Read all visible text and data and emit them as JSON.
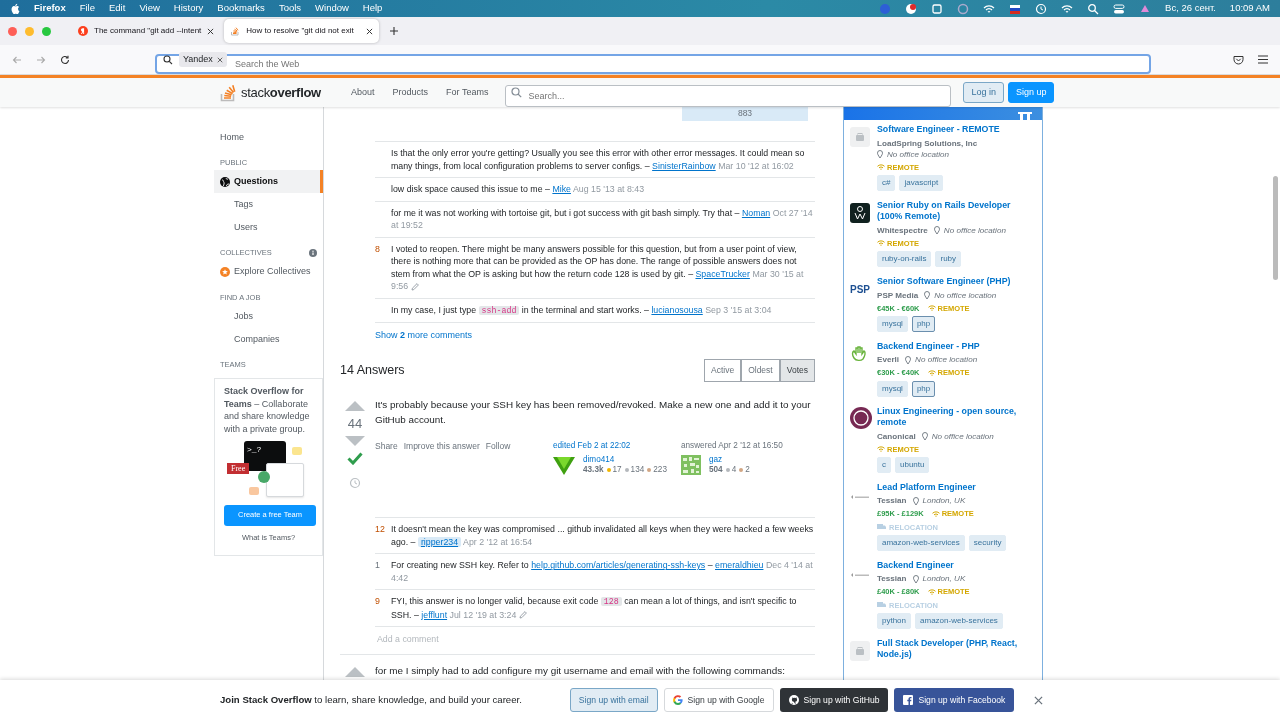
{
  "menubar": {
    "app": "Firefox",
    "items": [
      "File",
      "Edit",
      "View",
      "History",
      "Bookmarks",
      "Tools",
      "Window",
      "Help"
    ],
    "date": "Вс, 26 сент.",
    "time": "10:09 AM"
  },
  "browser_tabs": [
    {
      "title": "The command \"git add --intent",
      "selected": false
    },
    {
      "title": "How to resolve \"git did not exit",
      "selected": true
    }
  ],
  "address_bar": {
    "engine": "Yandex",
    "placeholder": "Search the Web"
  },
  "site_header": {
    "logo": "stack**overflow**",
    "nav": [
      "About",
      "Products",
      "For Teams"
    ],
    "search_placeholder": "Search...",
    "buttons": [
      {
        "kind": "secondary",
        "label": "Log in"
      },
      {
        "kind": "primary",
        "label": "Sign up"
      }
    ]
  },
  "sidebar": {
    "items": [
      {
        "kind": "link",
        "label": "Home",
        "selected": false
      },
      {
        "kind": "heading",
        "label": "PUBLIC"
      },
      {
        "kind": "link",
        "label": "Questions",
        "selected": true
      },
      {
        "kind": "sublink",
        "label": "Tags",
        "selected": false
      },
      {
        "kind": "sublink",
        "label": "Users",
        "selected": false
      },
      {
        "kind": "heading",
        "label": "COLLECTIVES",
        "info": true
      },
      {
        "kind": "link",
        "label": "Explore Collectives",
        "selected": false
      },
      {
        "kind": "heading",
        "label": "FIND A JOB"
      },
      {
        "kind": "sublink",
        "label": "Jobs",
        "selected": false
      },
      {
        "kind": "sublink",
        "label": "Companies",
        "selected": false
      },
      {
        "kind": "heading",
        "label": "TEAMS"
      }
    ],
    "teams_card": {
      "text": "**Stack Overflow for Teams** – Collaborate and share knowledge with a private group.",
      "terminal": ">_?",
      "badge": "Free",
      "button": "Create a free Team",
      "link": "What is Teams?"
    }
  },
  "question": {
    "views_box": "883",
    "comments": [
      {
        "segments": [
          {
            "kind": "text",
            "text": "Is that the only error you're getting? Usually you see this error with other error messages. It could mean so many things, from local configuration problems to server configs. –"
          }
        ],
        "user": "SinisterRainbow",
        "date": "Mar 10 '12 at 16:02",
        "edited": false
      },
      {
        "segments": [
          {
            "kind": "text",
            "text": "low disk space caused this issue to me –"
          }
        ],
        "user": "Mike",
        "date": "Aug 15 '13 at 8:43",
        "edited": false
      },
      {
        "segments": [
          {
            "kind": "text",
            "text": "for me it was not working with tortoise git, but i got success with git bash simply. Try that –"
          }
        ],
        "user": "Noman",
        "date": "Oct 27 '14 at 19:52",
        "edited": false
      },
      {
        "score": "8",
        "segments": [
          {
            "kind": "text",
            "text": "I voted to reopen. There might be many answers possible for this question, but from a user point of view, there is nothing more that can be provided as the OP has done. The range of possible answers does not stem from what the OP is asking but how the return code 128 is used by git. –"
          }
        ],
        "user": "SpaceTrucker",
        "date": "Mar 30 '15 at 9:56",
        "edited": true
      },
      {
        "segments": [
          {
            "kind": "text",
            "text": "In my case, I just type "
          },
          {
            "kind": "code",
            "text": "ssh-add"
          },
          {
            "kind": "text",
            "text": " in the terminal and start works. –"
          }
        ],
        "user": "lucianosousa",
        "date": "Sep 3 '15 at 3:04",
        "edited": false
      }
    ],
    "show_more": "Show **2** more comments"
  },
  "answers_header": {
    "title": "14 Answers",
    "sort": [
      {
        "label": "Active",
        "selected": false
      },
      {
        "label": "Oldest",
        "selected": false
      },
      {
        "label": "Votes",
        "selected": true
      }
    ]
  },
  "answer": {
    "score": "44",
    "accepted": true,
    "body": "It's probably because your SSH key has been removed/revoked. Make a new one and add it to your GitHub account.",
    "actions": [
      "Share",
      "Improve this answer",
      "Follow"
    ],
    "edited": {
      "label": "edited Feb 2 at 22:02",
      "user": "dimo414",
      "rep": "43.3k",
      "badges": [
        {
          "kind": "gold",
          "count": "17"
        },
        {
          "kind": "silver",
          "count": "134"
        },
        {
          "kind": "bronze",
          "count": "223"
        }
      ]
    },
    "answered": {
      "label": "answered Apr 2 '12 at 16:50",
      "user": "gaz",
      "rep": "504",
      "badges": [
        {
          "kind": "silver",
          "count": "4"
        },
        {
          "kind": "bronze",
          "count": "2"
        }
      ]
    },
    "comments": [
      {
        "score": "12",
        "segments": [
          {
            "kind": "text",
            "text": "It doesn't mean the key was compromised ... github invalidated all keys when they were hacked a few weeks ago. –"
          }
        ],
        "user": "ripper234",
        "op": true,
        "date": "Apr 2 '12 at 16:54",
        "edited": false
      },
      {
        "score": "1",
        "segments": [
          {
            "kind": "text",
            "text": "For creating new SSH key. Refer to "
          },
          {
            "kind": "link",
            "text": "help.github.com/articles/generating-ssh-keys"
          },
          {
            "kind": "text",
            "text": " –"
          }
        ],
        "user": "emeraldhieu",
        "op": false,
        "date": "Dec 4 '14 at 4:42",
        "edited": false
      },
      {
        "score": "9",
        "segments": [
          {
            "kind": "text",
            "text": "FYI, this answer is no longer valid, because exit code "
          },
          {
            "kind": "code",
            "text": "128"
          },
          {
            "kind": "text",
            "text": " can mean a lot of things, and isn't specific to SSH. –"
          }
        ],
        "user": "jefflunt",
        "op": false,
        "date": "Jul 12 '19 at 3:24",
        "edited": true
      }
    ],
    "add_comment": "Add a comment"
  },
  "next_answer": {
    "body": "for me I simply had to add configure my git username and email with the following commands:"
  },
  "jobs": [
    {
      "title": "Software Engineer - REMOTE",
      "company": "LoadSpring Solutions, Inc",
      "location": "No office location",
      "remote": "REMOTE",
      "tags": [
        {
          "label": "c#",
          "watched": false
        },
        {
          "label": "javascript",
          "watched": false
        }
      ]
    },
    {
      "title": "Senior Ruby on Rails Developer (100% Remote)",
      "company": "Whitespectre",
      "location": "No office location",
      "remote": "REMOTE",
      "tags": [
        {
          "label": "ruby-on-rails",
          "watched": false
        },
        {
          "label": "ruby",
          "watched": false
        }
      ]
    },
    {
      "logo_text": "PSP",
      "title": "Senior Software Engineer (PHP)",
      "company": "PSP Media",
      "location": "No office location",
      "salary": "€45K - €60K",
      "remote": "REMOTE",
      "tags": [
        {
          "label": "mysql",
          "watched": false
        },
        {
          "label": "php",
          "watched": true
        }
      ]
    },
    {
      "title": "Backend Engineer - PHP",
      "company": "Everli",
      "location": "No office location",
      "salary": "€30K - €40K",
      "remote": "REMOTE",
      "tags": [
        {
          "label": "mysql",
          "watched": false
        },
        {
          "label": "php",
          "watched": true
        }
      ]
    },
    {
      "title": "Linux Engineering - open source, remote",
      "company": "Canonical",
      "location": "No office location",
      "remote": "REMOTE",
      "tags": [
        {
          "label": "c",
          "watched": false
        },
        {
          "label": "ubuntu",
          "watched": false
        }
      ]
    },
    {
      "title": "Lead Platform Engineer",
      "company": "Tessian",
      "location": "London, UK",
      "salary": "£95K - £129K",
      "remote": "REMOTE",
      "relocation": "RELOCATION",
      "tags": [
        {
          "label": "amazon-web-services",
          "watched": false
        },
        {
          "label": "security",
          "watched": false
        }
      ]
    },
    {
      "title": "Backend Engineer",
      "company": "Tessian",
      "location": "London, UK",
      "salary": "£40K - £80K",
      "remote": "REMOTE",
      "relocation": "RELOCATION",
      "tags": [
        {
          "label": "python",
          "watched": false
        },
        {
          "label": "amazon-web-services",
          "watched": false
        }
      ]
    },
    {
      "title": "Full Stack Developer (PHP, React, Node.js)"
    }
  ],
  "signup_banner": {
    "text": "**Join Stack Overflow** to learn, share knowledge, and build your career.",
    "buttons": [
      {
        "kind": "email",
        "label": "Sign up with email"
      },
      {
        "kind": "google",
        "label": "Sign up with Google"
      },
      {
        "kind": "github",
        "label": "Sign up with GitHub"
      },
      {
        "kind": "facebook",
        "label": "Sign up with Facebook"
      }
    ]
  }
}
